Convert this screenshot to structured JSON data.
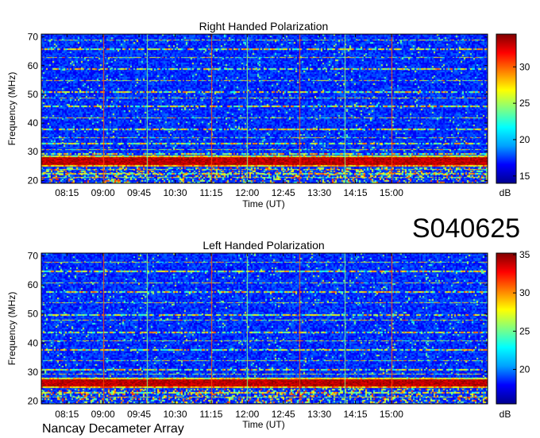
{
  "figure": {
    "station_code": "S040625",
    "footer_label": "Nancay Decameter Array"
  },
  "chart_data": [
    {
      "type": "heatmap",
      "title": "Right Handed Polarization",
      "xlabel": "Time (UT)",
      "ylabel": "Frequency (MHz)",
      "x_ticks": [
        "08:15",
        "09:00",
        "09:45",
        "10:30",
        "11:15",
        "12:00",
        "12:45",
        "13:30",
        "14:15",
        "15:00"
      ],
      "x_range_minutes_ut": [
        463,
        1020
      ],
      "y_ticks": [
        20,
        30,
        40,
        50,
        60,
        70
      ],
      "ylim": [
        19,
        71
      ],
      "colorbar": {
        "label": "dB",
        "ticks": [
          15,
          20,
          25,
          30
        ],
        "range": [
          14,
          34.5
        ]
      },
      "colormap": [
        "#00008f",
        "#0000ff",
        "#00a0ff",
        "#00ffff",
        "#80ff80",
        "#ffff00",
        "#ff8000",
        "#ff0000",
        "#800000"
      ],
      "features": {
        "strong_band_MHz": [
          25.5,
          28.0
        ],
        "interference_bands_MHz": [
          21.2,
          22.5,
          24.0,
          29.5,
          31,
          33,
          35,
          38,
          42,
          46,
          49,
          51,
          55,
          59,
          63,
          66,
          69
        ],
        "vertical_lines_UT": [
          "09:00",
          "09:55",
          "11:15",
          "12:00",
          "13:05",
          "14:02",
          "15:00"
        ]
      }
    },
    {
      "type": "heatmap",
      "title": "Left Handed Polarization",
      "xlabel": "Time (UT)",
      "ylabel": "Frequency (MHz)",
      "x_ticks": [
        "08:15",
        "09:00",
        "09:45",
        "10:30",
        "11:15",
        "12:00",
        "12:45",
        "13:30",
        "14:15",
        "15:00"
      ],
      "x_range_minutes_ut": [
        463,
        1020
      ],
      "y_ticks": [
        20,
        30,
        40,
        50,
        60,
        70
      ],
      "ylim": [
        19,
        71
      ],
      "colorbar": {
        "label": "dB",
        "ticks": [
          20,
          25,
          30,
          35
        ],
        "range": [
          15.5,
          35.2
        ]
      },
      "colormap": [
        "#00008f",
        "#0000ff",
        "#00a0ff",
        "#00ffff",
        "#80ff80",
        "#ffff00",
        "#ff8000",
        "#ff0000",
        "#800000"
      ],
      "features": {
        "strong_band_MHz": [
          25.0,
          27.5
        ],
        "interference_bands_MHz": [
          21.5,
          23.0,
          29.5,
          31,
          34,
          38,
          41,
          44,
          48,
          50,
          54,
          58,
          61,
          65,
          68
        ],
        "vertical_lines_UT": [
          "09:00",
          "09:55",
          "11:15",
          "12:00",
          "13:05",
          "14:02",
          "15:00"
        ]
      }
    }
  ]
}
